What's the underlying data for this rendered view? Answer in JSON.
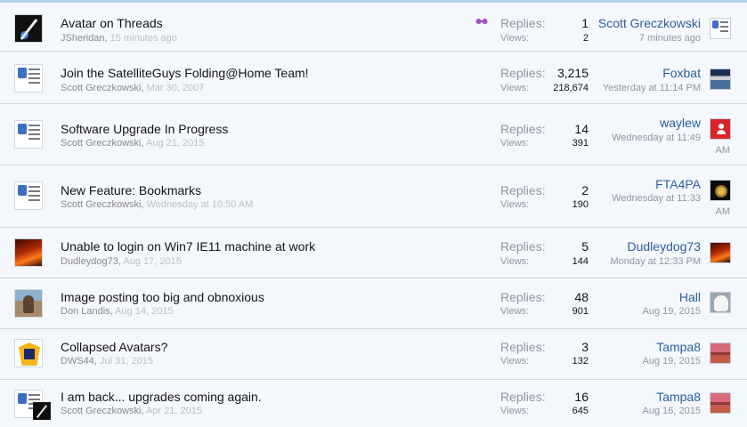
{
  "threads": [
    {
      "title": "Avatar on Threads",
      "author": "JSheridan",
      "date": "15 minutes ago",
      "has_tool_icon": true,
      "replies_label": "Replies:",
      "replies": "1",
      "views_label": "Views:",
      "views": "2",
      "last_user": "Scott Greczkowski",
      "last_time": "7 minutes ago",
      "last_time_cont": ""
    },
    {
      "title": "Join the SatelliteGuys Folding@Home Team!",
      "author": "Scott Greczkowski",
      "date": "Mar 30, 2007",
      "replies_label": "Replies:",
      "replies": "3,215",
      "views_label": "Views:",
      "views": "218,674",
      "last_user": "Foxbat",
      "last_time": "Yesterday at 11:14 PM",
      "last_time_cont": ""
    },
    {
      "title": "Software Upgrade In Progress",
      "author": "Scott Greczkowski",
      "date": "Aug 21, 2015",
      "replies_label": "Replies:",
      "replies": "14",
      "views_label": "Views:",
      "views": "391",
      "last_user": "waylew",
      "last_time": "Wednesday at 11:49",
      "last_time_cont": "AM"
    },
    {
      "title": "New Feature: Bookmarks",
      "author": "Scott Greczkowski",
      "date": "Wednesday at 10:50 AM",
      "replies_label": "Replies:",
      "replies": "2",
      "views_label": "Views:",
      "views": "190",
      "last_user": "FTA4PA",
      "last_time": "Wednesday at 11:33",
      "last_time_cont": "AM"
    },
    {
      "title": "Unable to login on Win7 IE11 machine at work",
      "author": "Dudleydog73",
      "date": "Aug 17, 2015",
      "replies_label": "Replies:",
      "replies": "5",
      "views_label": "Views:",
      "views": "144",
      "last_user": "Dudleydog73",
      "last_time": "Monday at 12:33 PM",
      "last_time_cont": ""
    },
    {
      "title": "Image posting too big and obnoxious",
      "author": "Don Landis",
      "date": "Aug 14, 2015",
      "replies_label": "Replies:",
      "replies": "48",
      "views_label": "Views:",
      "views": "901",
      "last_user": "Hall",
      "last_time": "Aug 19, 2015",
      "last_time_cont": ""
    },
    {
      "title": "Collapsed Avatars?",
      "author": "DWS44",
      "date": "Jul 31, 2015",
      "replies_label": "Replies:",
      "replies": "3",
      "views_label": "Views:",
      "views": "132",
      "last_user": "Tampa8",
      "last_time": "Aug 19, 2015",
      "last_time_cont": ""
    },
    {
      "title": "I am back... upgrades coming again.",
      "author": "Scott Greczkowski",
      "date": "Apr 21, 2015",
      "replies_label": "Replies:",
      "replies": "16",
      "views_label": "Views:",
      "views": "645",
      "last_user": "Tampa8",
      "last_time": "Aug 16, 2015",
      "last_time_cont": ""
    }
  ],
  "icons": {
    "tool_icon": "glasses-icon"
  }
}
